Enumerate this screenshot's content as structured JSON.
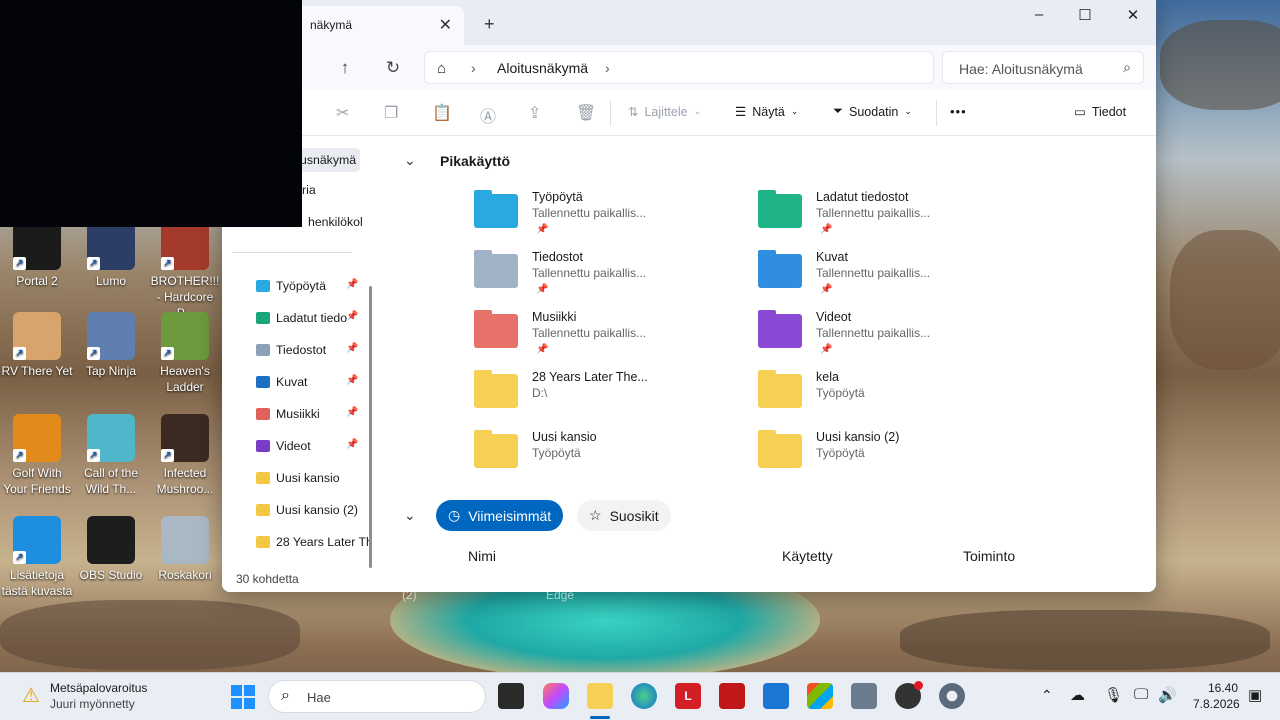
{
  "desktop": {
    "icons": [
      {
        "label": "Portal 2",
        "color": "#1b1b1b"
      },
      {
        "label": "Lumo",
        "color": "#2c3e66"
      },
      {
        "label": "BROTHER!!! - Hardcore P...",
        "color": "#a33a2c"
      },
      {
        "label": "RV There Yet",
        "color": "#d7a46b"
      },
      {
        "label": "Tap Ninja",
        "color": "#5f7fb0"
      },
      {
        "label": "Heaven's Ladder",
        "color": "#6c9a3c"
      },
      {
        "label": "Golf With Your Friends",
        "color": "#e28a1a"
      },
      {
        "label": "Call of the Wild Th...",
        "color": "#4fb7c9"
      },
      {
        "label": "Infected Mushroo...",
        "color": "#3a2a22"
      },
      {
        "label": "Lisätietoja tästä kuvasta",
        "color": "#1e8fe0"
      },
      {
        "label": "OBS Studio",
        "color": "#1d1d1d"
      },
      {
        "label": "Roskakori",
        "color": "#aab8c6"
      }
    ],
    "bg_labels": [
      "(2)",
      "Edge"
    ]
  },
  "explorer": {
    "tab_title": "näkymä",
    "new_tab": "+",
    "window_controls": [
      "–",
      "☐",
      "✕"
    ],
    "breadcrumb": "Aloitusnäkymä",
    "search_placeholder": "Hae: Aloitusnäkymä",
    "toolbar": {
      "sort": "Lajittele",
      "view": "Näytä",
      "filter": "Suodatin",
      "more": "•••",
      "details": "Tiedot"
    },
    "sidebar": {
      "top_items": [
        "usnäkymä",
        "ria",
        "henkilökol"
      ],
      "items": [
        {
          "label": "Työpöytä",
          "color": "#2aa9e0",
          "pinned": true
        },
        {
          "label": "Ladatut tiedo",
          "color": "#1aa57a",
          "pinned": true
        },
        {
          "label": "Tiedostot",
          "color": "#8aa1b8",
          "pinned": true
        },
        {
          "label": "Kuvat",
          "color": "#1c6fc4",
          "pinned": true
        },
        {
          "label": "Musiikki",
          "color": "#e0605a",
          "pinned": true
        },
        {
          "label": "Videot",
          "color": "#7a3cc8",
          "pinned": true
        },
        {
          "label": "Uusi kansio",
          "color": "#f5c842",
          "pinned": false
        },
        {
          "label": "Uusi kansio (2)",
          "color": "#f5c842",
          "pinned": false
        },
        {
          "label": "28 Years Later Th",
          "color": "#f5c842",
          "pinned": false
        }
      ],
      "status": "30 kohdetta"
    },
    "quick_access": {
      "title": "Pikakäyttö",
      "items": [
        {
          "name": "Työpöytä",
          "sub": "Tallennettu paikallis...",
          "pinned": true,
          "color": "#2aa9e0"
        },
        {
          "name": "Ladatut tiedostot",
          "sub": "Tallennettu paikallis...",
          "pinned": true,
          "color": "#1fb487"
        },
        {
          "name": "Tiedostot",
          "sub": "Tallennettu paikallis...",
          "pinned": true,
          "color": "#9fb2c6"
        },
        {
          "name": "Kuvat",
          "sub": "Tallennettu paikallis...",
          "pinned": true,
          "color": "#2f8ee0"
        },
        {
          "name": "Musiikki",
          "sub": "Tallennettu paikallis...",
          "pinned": true,
          "color": "#e8726a"
        },
        {
          "name": "Videot",
          "sub": "Tallennettu paikallis...",
          "pinned": true,
          "color": "#8a4ad6"
        },
        {
          "name": "28 Years Later The...",
          "sub": "D:\\",
          "pinned": false,
          "color": "#f6cf55"
        },
        {
          "name": "kela",
          "sub": "Työpöytä",
          "pinned": false,
          "color": "#f6cf55"
        },
        {
          "name": "Uusi kansio",
          "sub": "Työpöytä",
          "pinned": false,
          "color": "#f6cf55"
        },
        {
          "name": "Uusi kansio (2)",
          "sub": "Työpöytä",
          "pinned": false,
          "color": "#f6cf55"
        }
      ]
    },
    "recent": {
      "tab_recent": "Viimeisimmät",
      "tab_favorites": "Suosikit",
      "columns": [
        "Nimi",
        "Käytetty",
        "Toiminto"
      ]
    }
  },
  "taskbar": {
    "notification_title": "Metsäpalovaroitus",
    "notification_sub": "Juuri myönnetty",
    "search_placeholder": "Hae",
    "time": "16.40",
    "date": "7.8.2026",
    "accent": "#0067c0"
  }
}
